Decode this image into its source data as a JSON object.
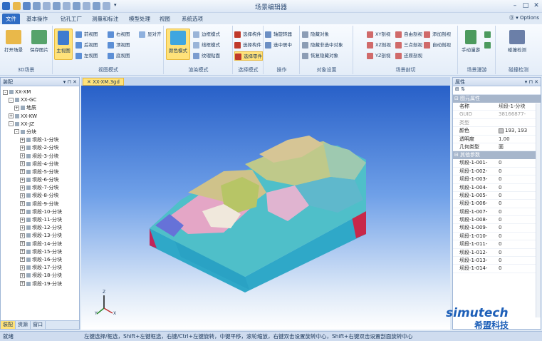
{
  "window": {
    "title": "场景编辑器",
    "options": "Options"
  },
  "tabs": [
    "文件",
    "基本操作",
    "钻孔工厂",
    "测量和标注",
    "模型处理",
    "视图",
    "系统选项"
  ],
  "ribbon": {
    "groups": [
      "3D场景",
      "视图模式",
      "渲染模式",
      "选择模式",
      "操作",
      "对象设置",
      "场景剖切",
      "场景漫游",
      "碰撞检测"
    ],
    "file_group": {
      "open": "打开场景",
      "save_image": "保存图片"
    },
    "view_group": {
      "main_view": "主视图",
      "front": "前视图",
      "back": "后视图",
      "left": "左视图",
      "right": "右视图",
      "top": "顶视图",
      "bottom": "底视图",
      "fit": "显对齐"
    },
    "render_group": {
      "color_mode": "颜色模式",
      "wire_mode": "边框模式",
      "frame_mode": "线框模式",
      "texture": "纹理贴面"
    },
    "select_group": {
      "select_object": "选择构件",
      "select_layer": "选择构件",
      "select_part": "选择零件"
    },
    "operate_group": {
      "rotate": "轴旋转器",
      "center": "选中居中"
    },
    "object_group": {
      "hide": "隐藏对象",
      "hide_others": "隐藏非选中对象",
      "restore": "恢复隐藏对象"
    },
    "section_group": {
      "xy": "XY剖视",
      "xz": "XZ剖视",
      "yz": "YZ剖视",
      "free": "自由剖视",
      "three": "三点剖视",
      "restore": "还原剖视",
      "add": "添加剖视",
      "auto": "自动剖视"
    },
    "walk_group": {
      "manual": "手动漫游"
    },
    "collide_group": {
      "check": "碰撞检测"
    }
  },
  "left_panel": {
    "title": "装配",
    "tree": [
      {
        "level": 0,
        "expander": "-",
        "label": "XX-XM"
      },
      {
        "level": 1,
        "expander": "-",
        "label": "XX-GC"
      },
      {
        "level": 2,
        "expander": "+",
        "label": "地质"
      },
      {
        "level": 1,
        "expander": "+",
        "label": "XX-KW"
      },
      {
        "level": 1,
        "expander": "-",
        "label": "XX-JZ"
      },
      {
        "level": 2,
        "expander": "-",
        "label": "分块"
      },
      {
        "level": 3,
        "expander": "+",
        "label": "坝段-1-分块"
      },
      {
        "level": 3,
        "expander": "+",
        "label": "坝段-2-分块"
      },
      {
        "level": 3,
        "expander": "+",
        "label": "坝段-3-分块"
      },
      {
        "level": 3,
        "expander": "+",
        "label": "坝段-4-分块"
      },
      {
        "level": 3,
        "expander": "+",
        "label": "坝段-5-分块"
      },
      {
        "level": 3,
        "expander": "+",
        "label": "坝段-6-分块"
      },
      {
        "level": 3,
        "expander": "+",
        "label": "坝段-7-分块"
      },
      {
        "level": 3,
        "expander": "+",
        "label": "坝段-8-分块"
      },
      {
        "level": 3,
        "expander": "+",
        "label": "坝段-9-分块"
      },
      {
        "level": 3,
        "expander": "+",
        "label": "坝段-10-分块"
      },
      {
        "level": 3,
        "expander": "+",
        "label": "坝段-11-分块"
      },
      {
        "level": 3,
        "expander": "+",
        "label": "坝段-12-分块"
      },
      {
        "level": 3,
        "expander": "+",
        "label": "坝段-13-分块"
      },
      {
        "level": 3,
        "expander": "+",
        "label": "坝段-14-分块"
      },
      {
        "level": 3,
        "expander": "+",
        "label": "坝段-15-分块"
      },
      {
        "level": 3,
        "expander": "+",
        "label": "坝段-16-分块"
      },
      {
        "level": 3,
        "expander": "+",
        "label": "坝段-17-分块"
      },
      {
        "level": 3,
        "expander": "+",
        "label": "坝段-18-分块"
      },
      {
        "level": 3,
        "expander": "+",
        "label": "坝段-19-分块"
      }
    ],
    "bottom_tabs": [
      "装配",
      "资源",
      "窗口"
    ]
  },
  "document": {
    "tab": "XX-XM.3gd"
  },
  "right_panel": {
    "title": "属性",
    "section_basic": "图元属性",
    "basic": [
      {
        "k": "名称",
        "v": "坝段-1-分块",
        "gray": false
      },
      {
        "k": "GUID",
        "v": "38166877-",
        "gray": true
      },
      {
        "k": "类型",
        "v": "",
        "gray": true
      }
    ],
    "color_label": "颜色",
    "color_value": "193, 193",
    "color_hex": "#c1c1c3",
    "more": [
      {
        "k": "透明度",
        "v": "1.00"
      },
      {
        "k": "几何类型",
        "v": "面"
      }
    ],
    "section_other": "其他参数",
    "params": [
      {
        "k": "坝段-1-001-",
        "v": "0"
      },
      {
        "k": "坝段-1-002-",
        "v": "0"
      },
      {
        "k": "坝段-1-003-",
        "v": "0"
      },
      {
        "k": "坝段-1-004-",
        "v": "0"
      },
      {
        "k": "坝段-1-005-",
        "v": "0"
      },
      {
        "k": "坝段-1-006-",
        "v": "0"
      },
      {
        "k": "坝段-1-007-",
        "v": "0"
      },
      {
        "k": "坝段-1-008-",
        "v": "0"
      },
      {
        "k": "坝段-1-009-",
        "v": "0"
      },
      {
        "k": "坝段-1-010-",
        "v": "0"
      },
      {
        "k": "坝段-1-011-",
        "v": "0"
      },
      {
        "k": "坝段-1-012-",
        "v": "0"
      },
      {
        "k": "坝段-1-013-",
        "v": "0"
      },
      {
        "k": "坝段-1-014-",
        "v": "0"
      }
    ]
  },
  "status": {
    "left": "就绪",
    "hint": "左键选择/框选，Shift+左键框选，右键/Ctrl+左键旋转，中键平移，滚轮缩放，右键双击设置旋转中心，Shift+右键双击设置剖面旋转中心"
  },
  "axis": {
    "x": "X",
    "y": "Y",
    "z": "Z"
  },
  "watermark": {
    "brand": "simutech",
    "cn": "希盟科技"
  }
}
